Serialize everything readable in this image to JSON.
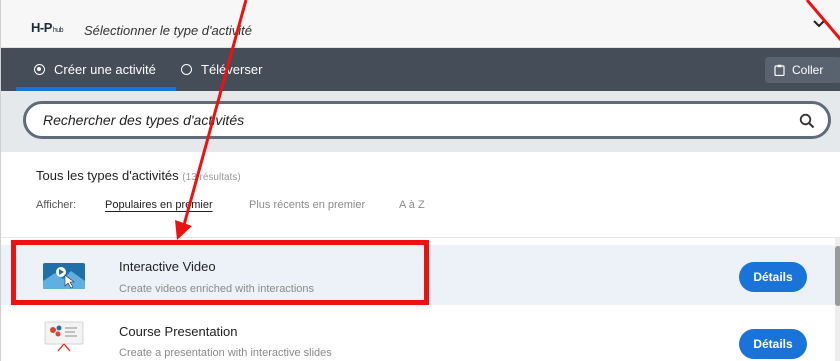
{
  "header": {
    "logo": "H-P",
    "logo_sub": "hub",
    "title": "Sélectionner le type d'activité"
  },
  "tabs": [
    {
      "label": "Créer une activité",
      "selected": true
    },
    {
      "label": "Téléverser",
      "selected": false
    }
  ],
  "paste_button": {
    "label": "Coller",
    "icon": "clipboard-icon"
  },
  "search": {
    "placeholder": "Rechercher des types d'activités",
    "icon": "search-icon"
  },
  "results": {
    "title": "Tous les types d'activités",
    "count": "(13 résultats)"
  },
  "sort": {
    "label": "Afficher:",
    "options": [
      "Populaires en premier",
      "Plus récents en premier",
      "A à Z"
    ],
    "active": "Populaires en premier"
  },
  "content_types": [
    {
      "name": "Interactive Video",
      "description": "Create videos enriched with interactions",
      "button": "Détails",
      "highlighted": true
    },
    {
      "name": "Course Presentation",
      "description": "Create a presentation with interactive slides",
      "button": "Détails",
      "highlighted": false
    }
  ],
  "colors": {
    "accent": "#1a73d9",
    "tabs_bg": "#444d58",
    "annotation": "#ee1111",
    "selected_row_bg": "#edf2f8"
  }
}
